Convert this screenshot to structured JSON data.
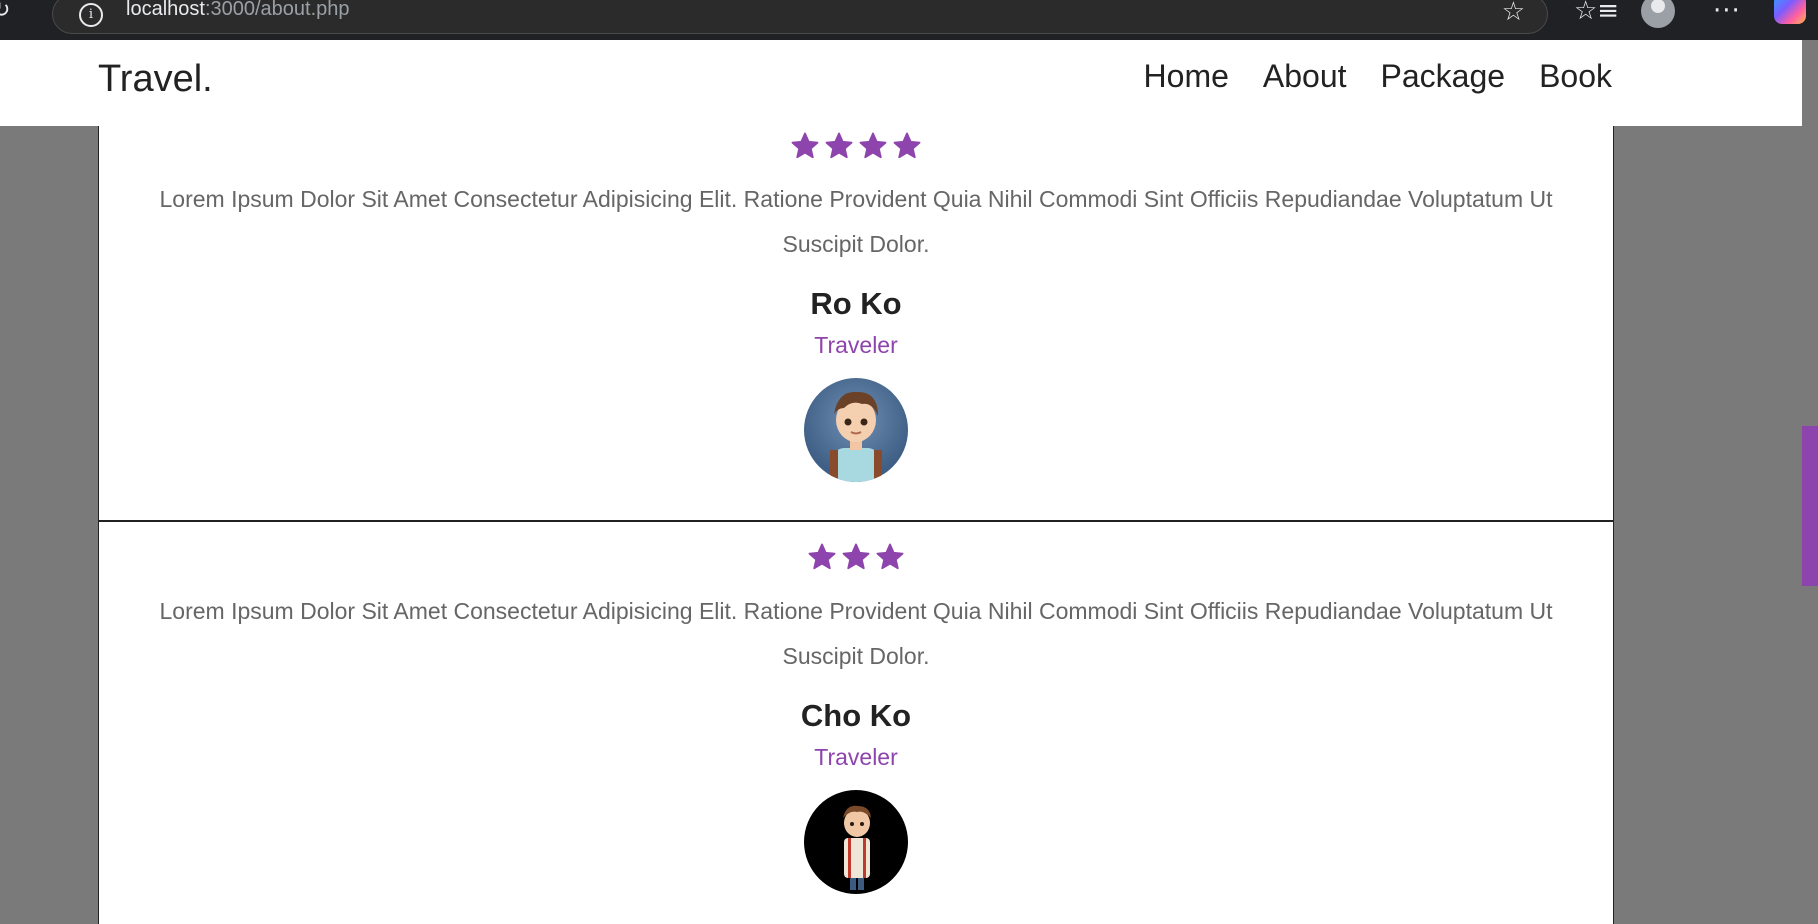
{
  "browser": {
    "url_host": "localhost",
    "url_rest": ":3000/about.php"
  },
  "site": {
    "logo": "Travel.",
    "nav": [
      "Home",
      "About",
      "Package",
      "Book"
    ]
  },
  "colors": {
    "accent": "#8e44ad",
    "page_bg": "#7a7a7a"
  },
  "reviews": [
    {
      "rating": 4,
      "text": "Lorem Ipsum Dolor Sit Amet Consectetur Adipisicing Elit. Ratione Provident Quia Nihil Commodi Sint Officiis Repudiandae Voluptatum Ut Suscipit Dolor.",
      "name": "Ro Ko",
      "role": "Traveler",
      "avatar_icon": "boy-avatar-icon"
    },
    {
      "rating": 3,
      "text": "Lorem Ipsum Dolor Sit Amet Consectetur Adipisicing Elit. Ratione Provident Quia Nihil Commodi Sint Officiis Repudiandae Voluptatum Ut Suscipit Dolor.",
      "name": "Cho Ko",
      "role": "Traveler",
      "avatar_icon": "boy-avatar-icon"
    }
  ]
}
